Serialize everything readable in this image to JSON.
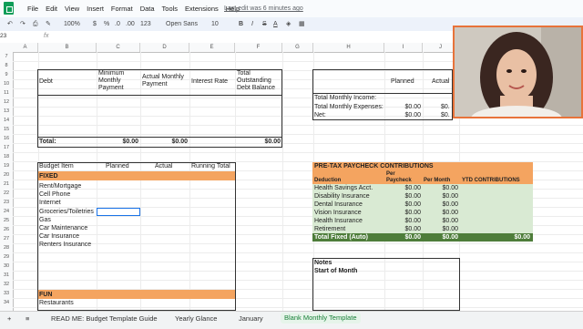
{
  "menu": [
    "File",
    "Edit",
    "View",
    "Insert",
    "Format",
    "Data",
    "Tools",
    "Extensions",
    "Help"
  ],
  "last_edit": "Last edit was 6 minutes ago",
  "toolbar": {
    "zoom": "100%",
    "currency": "$",
    "percent": "%",
    "dec1": ".0",
    "dec2": ".00",
    "numfmt": "123",
    "font": "Open Sans",
    "size": "10"
  },
  "cell_ref": "23",
  "fx_label": "fx",
  "columns": [
    "A",
    "B",
    "C",
    "D",
    "E",
    "F",
    "G",
    "H",
    "I",
    "J"
  ],
  "rows": [
    "7",
    "8",
    "9",
    "10",
    "11",
    "12",
    "13",
    "14",
    "15",
    "16",
    "17",
    "18",
    "19",
    "20",
    "21",
    "22",
    "23",
    "24",
    "25",
    "26",
    "27",
    "28",
    "29",
    "30",
    "31",
    "32",
    "33",
    "34"
  ],
  "debt_table": {
    "headers": [
      "Debt",
      "Minimum Monthly Payment",
      "Actual Monthly Payment",
      "Interest Rate",
      "Total Outstanding Debt Balance"
    ],
    "total_label": "Total:",
    "totals": [
      "$0.00",
      "$0.00",
      "$0.00"
    ]
  },
  "summary": {
    "planned": "Planned",
    "actual": "Actual",
    "rows": [
      {
        "label": "Total Monthly Income:",
        "planned": "",
        "actual": ""
      },
      {
        "label": "Total Monthly Expenses:",
        "planned": "$0.00",
        "actual": "$0."
      },
      {
        "label": "Net:",
        "planned": "$0.00",
        "actual": "$0."
      }
    ]
  },
  "budget": {
    "headers": [
      "Budget Item",
      "Planned",
      "Actual",
      "Running Total"
    ],
    "fixed_label": "FIXED",
    "fixed_items": [
      "Rent/Mortgage",
      "Cell Phone",
      "Internet",
      "Groceries/Toiletries",
      "Gas",
      "Car Maintenance",
      "Car Insurance",
      "Renters Insurance"
    ],
    "fun_label": "FUN",
    "fun_items": [
      "Restaurants"
    ]
  },
  "pretax": {
    "title": "PRE-TAX PAYCHECK CONTRIBUTIONS",
    "headers": [
      "Deduction",
      "Per Paycheck",
      "Per Month",
      "YTD CONTRIBUTIONS"
    ],
    "rows": [
      {
        "label": "Health Savings Acct.",
        "pp": "$0.00",
        "pm": "$0.00"
      },
      {
        "label": "Disability Insurance",
        "pp": "$0.00",
        "pm": "$0.00"
      },
      {
        "label": "Dental Insurance",
        "pp": "$0.00",
        "pm": "$0.00"
      },
      {
        "label": "Vision Insurance",
        "pp": "$0.00",
        "pm": "$0.00"
      },
      {
        "label": "Health Insurance",
        "pp": "$0.00",
        "pm": "$0.00"
      },
      {
        "label": "Retirement",
        "pp": "$0.00",
        "pm": "$0.00"
      }
    ],
    "total": {
      "label": "Total Fixed (Auto)",
      "pp": "$0.00",
      "pm": "$0.00",
      "ytd": "$0.00"
    }
  },
  "notes": {
    "title": "Notes",
    "subtitle": "Start of Month"
  },
  "tabs": [
    "READ ME: Budget Template Guide",
    "Yearly Glance",
    "January",
    "Blank Monthly Template"
  ],
  "colors": {
    "orange": "#f4a460",
    "green_light": "#d9ead3",
    "green_dark": "#4e7d3a",
    "accent": "#e8733a"
  }
}
